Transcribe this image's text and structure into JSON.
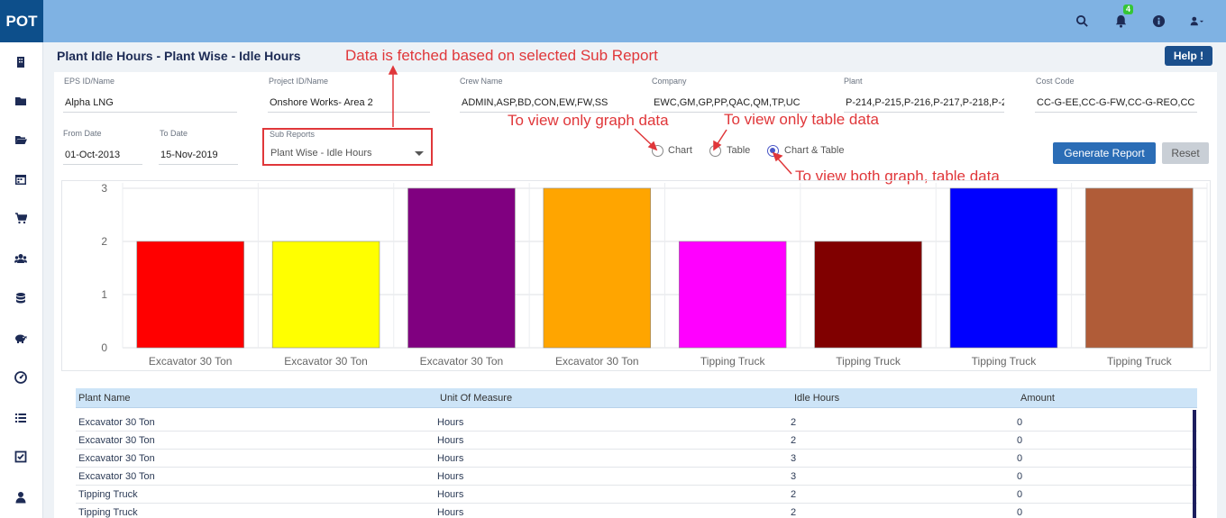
{
  "app": {
    "logo": "POT",
    "notification_count": "4"
  },
  "page": {
    "title": "Plant Idle Hours - Plant Wise - Idle Hours",
    "help_label": "Help !"
  },
  "filters": {
    "eps": {
      "label": "EPS ID/Name",
      "value": "Alpha LNG"
    },
    "project": {
      "label": "Project ID/Name",
      "value": "Onshore  Works- Area 2"
    },
    "crew": {
      "label": "Crew Name",
      "value": "ADMIN,ASP,BD,CON,EW,FW,SS"
    },
    "company": {
      "label": "Company",
      "value": "EWC,GM,GP,PP,QAC,QM,TP,UC"
    },
    "plant": {
      "label": "Plant",
      "value": "P-214,P-215,P-216,P-217,P-218,P-2"
    },
    "cost_code": {
      "label": "Cost Code",
      "value": "CC-G-EE,CC-G-FW,CC-G-REO,CC"
    },
    "from_date": {
      "label": "From Date",
      "value": "01-Oct-2013"
    },
    "to_date": {
      "label": "To Date",
      "value": "15-Nov-2019"
    },
    "sub_reports": {
      "label": "Sub Reports",
      "value": "Plant Wise - Idle Hours"
    }
  },
  "view_options": {
    "chart": "Chart",
    "table": "Table",
    "both": "Chart & Table",
    "selected": "Chart & Table"
  },
  "buttons": {
    "generate": "Generate Report",
    "reset": "Reset"
  },
  "annotations": {
    "sub_report": "Data is fetched based on selected Sub Report",
    "graph": "To view only graph data",
    "table": "To view only table data",
    "both": "To view both graph, table data",
    "color": "#e0373a"
  },
  "chart_data": {
    "type": "bar",
    "categories": [
      "Excavator 30 Ton",
      "Excavator 30 Ton",
      "Excavator 30 Ton",
      "Excavator 30 Ton",
      "Tipping Truck",
      "Tipping Truck",
      "Tipping Truck",
      "Tipping Truck"
    ],
    "values": [
      2,
      2,
      3,
      3,
      2,
      2,
      3,
      3
    ],
    "colors": [
      "#ff0000",
      "#ffff00",
      "#800080",
      "#ffa500",
      "#ff00ff",
      "#800000",
      "#0000ff",
      "#b05c38"
    ],
    "yticks": [
      0,
      1,
      2,
      3
    ],
    "ylim": [
      0,
      3
    ],
    "grid": true
  },
  "table": {
    "headers": [
      "Plant Name",
      "Unit Of Measure",
      "Idle Hours",
      "Amount"
    ],
    "rows": [
      [
        "Excavator 30 Ton",
        "Hours",
        "2",
        "0"
      ],
      [
        "Excavator 30 Ton",
        "Hours",
        "2",
        "0"
      ],
      [
        "Excavator 30 Ton",
        "Hours",
        "3",
        "0"
      ],
      [
        "Excavator 30 Ton",
        "Hours",
        "3",
        "0"
      ],
      [
        "Tipping Truck",
        "Hours",
        "2",
        "0"
      ],
      [
        "Tipping Truck",
        "Hours",
        "2",
        "0"
      ]
    ]
  }
}
